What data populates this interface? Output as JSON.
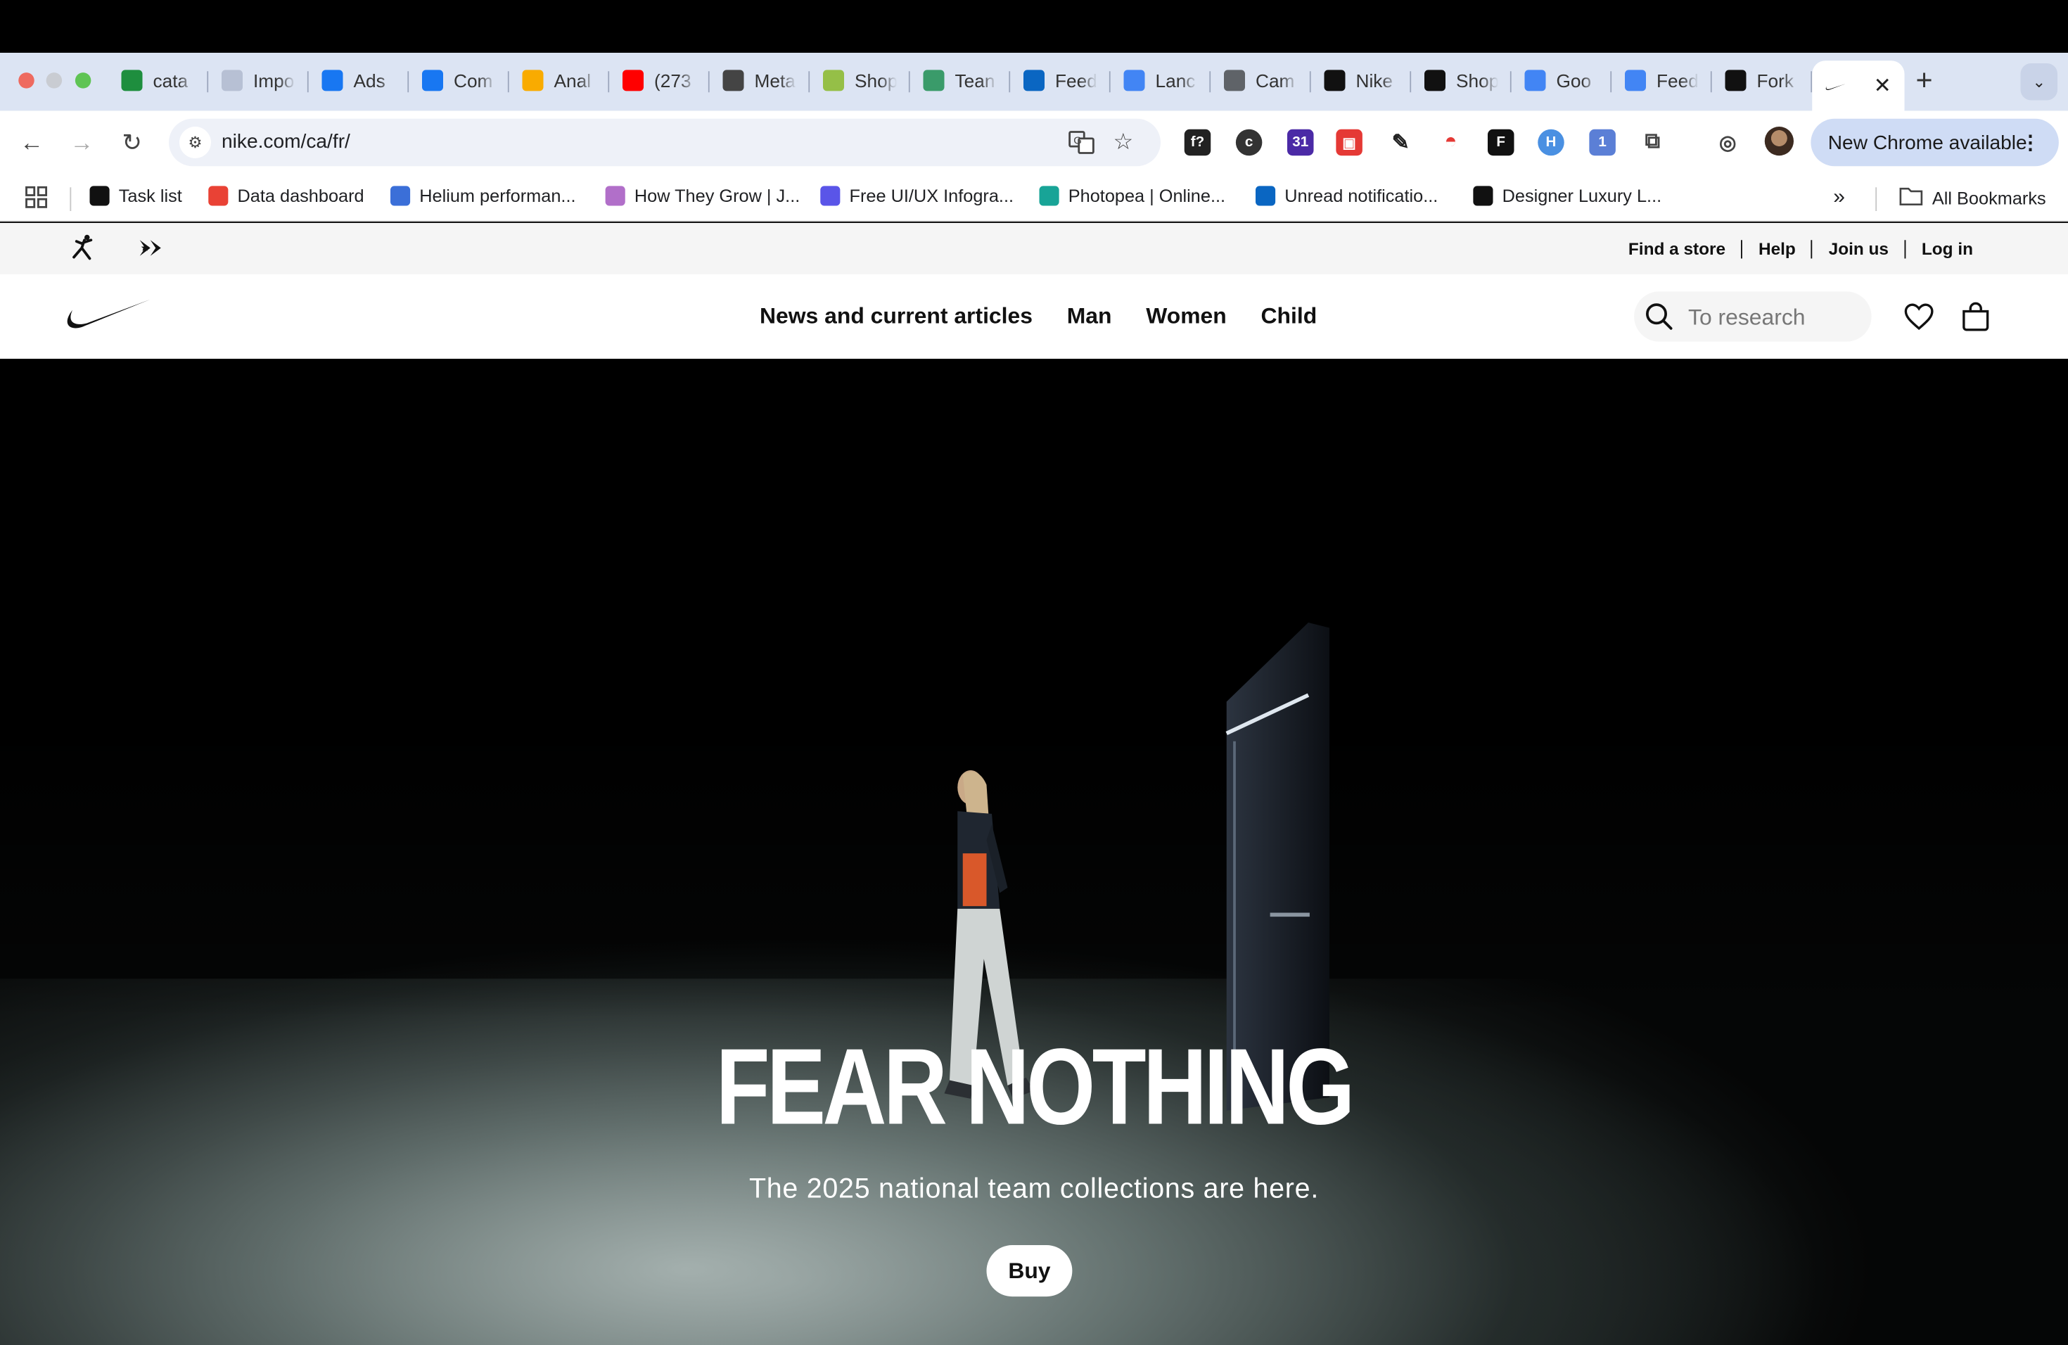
{
  "browser": {
    "tabs": [
      {
        "title": "cata",
        "fav": "sheets-icon",
        "color": "#1e8e3e"
      },
      {
        "title": "Impo",
        "fav": "import-icon",
        "color": "#b7c0d4"
      },
      {
        "title": "Ads",
        "fav": "meta-icon",
        "color": "#1877f2"
      },
      {
        "title": "Com",
        "fav": "meta-icon",
        "color": "#1877f2"
      },
      {
        "title": "Anal",
        "fav": "analytics-icon",
        "color": "#f9ab00"
      },
      {
        "title": "(273",
        "fav": "youtube-icon",
        "color": "#ff0000"
      },
      {
        "title": "Meta",
        "fav": "openai-icon",
        "color": "#444444"
      },
      {
        "title": "Shop",
        "fav": "shopify-icon",
        "color": "#95bf47"
      },
      {
        "title": "Tean",
        "fav": "team-icon",
        "color": "#3a9b6a"
      },
      {
        "title": "Feed",
        "fav": "linkedin-icon",
        "color": "#0a66c2"
      },
      {
        "title": "Lanc",
        "fav": "docs-icon",
        "color": "#4285f4"
      },
      {
        "title": "Cam",
        "fav": "globe-icon",
        "color": "#5f6368"
      },
      {
        "title": "Nike",
        "fav": "nike-icon",
        "color": "#111111"
      },
      {
        "title": "Shop",
        "fav": "su-icon",
        "color": "#111111"
      },
      {
        "title": "Goo",
        "fav": "docs-icon",
        "color": "#4285f4"
      },
      {
        "title": "Feed",
        "fav": "docs-icon",
        "color": "#4285f4"
      },
      {
        "title": "Fork",
        "fav": "fork-icon",
        "color": "#111111"
      }
    ],
    "url": "nike.com/ca/fr/",
    "update_label": "New Chrome available",
    "bookmarks": [
      {
        "label": "Task list",
        "icon": "notion-icon",
        "color": "#111111"
      },
      {
        "label": "Data dashboard",
        "icon": "dashboard-icon",
        "color": "#e94235"
      },
      {
        "label": "Helium performan...",
        "icon": "helium-icon",
        "color": "#3b6fd8"
      },
      {
        "label": "How They Grow | J...",
        "icon": "plant-icon",
        "color": "#b16fc9"
      },
      {
        "label": "Free UI/UX Infogra...",
        "icon": "uiux-icon",
        "color": "#5a55e8"
      },
      {
        "label": "Photopea | Online...",
        "icon": "photopea-icon",
        "color": "#18a497"
      },
      {
        "label": "Unread notificatio...",
        "icon": "linkedin-icon",
        "color": "#0a66c2"
      },
      {
        "label": "Designer Luxury L...",
        "icon": "luxury-icon",
        "color": "#111111"
      }
    ],
    "all_bookmarks_label": "All Bookmarks"
  },
  "nike": {
    "utility_links": [
      "Find a store",
      "Help",
      "Join us",
      "Log in"
    ],
    "nav": [
      "News and current articles",
      "Man",
      "Women",
      "Child"
    ],
    "search_placeholder": "To research",
    "hero": {
      "title": "FEAR NOTHING",
      "subtitle": "The 2025 national team collections are here.",
      "cta": "Buy"
    }
  }
}
